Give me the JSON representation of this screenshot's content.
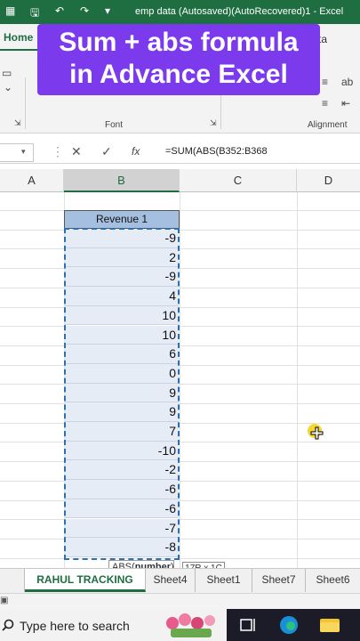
{
  "window": {
    "title": "emp data (Autosaved)(AutoRecovered)1 - Excel"
  },
  "ribbon": {
    "tabs": {
      "home": "Home",
      "data_partial": "ta"
    },
    "groups": {
      "font": "Font",
      "alignment": "Alignment"
    }
  },
  "overlay": {
    "line1": "Sum + abs formula",
    "line2": "in Advance Excel",
    "bg_color": "#7c3aed"
  },
  "formula_bar": {
    "formula": "=SUM(ABS(B352:B368",
    "fx_label": "fx"
  },
  "columns": [
    "A",
    "B",
    "C",
    "D"
  ],
  "table": {
    "header": "Revenue 1",
    "values": [
      "-9",
      "2",
      "-9",
      "4",
      "10",
      "10",
      "6",
      "0",
      "9",
      "9",
      "7",
      "-10",
      "-2",
      "-6",
      "-6",
      "-7",
      "-8"
    ]
  },
  "tooltip": {
    "func": "ABS(",
    "arg": "number",
    "close": ")"
  },
  "selection_size": "17R x 1C",
  "sheets": [
    {
      "name": "RAHUL TRACKING",
      "active": true
    },
    {
      "name": "Sheet4",
      "active": false
    },
    {
      "name": "Sheet1",
      "active": false
    },
    {
      "name": "Sheet7",
      "active": false
    },
    {
      "name": "Sheet6",
      "active": false
    }
  ],
  "taskbar": {
    "search_placeholder": "Type here to search"
  },
  "colors": {
    "excel_green": "#1e6e42",
    "header_fill": "#a4bfdf",
    "selection_fill": "#e6ecf6"
  }
}
